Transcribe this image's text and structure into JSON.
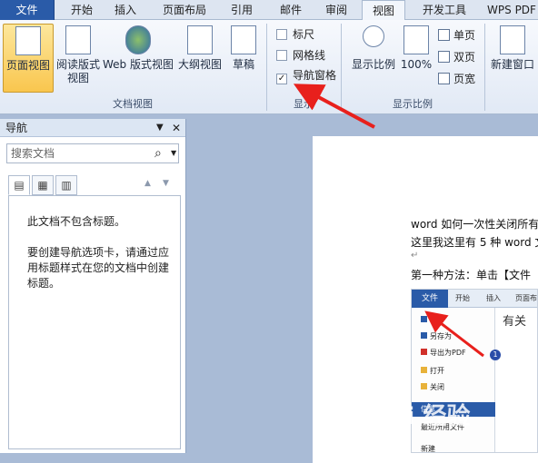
{
  "tabs": [
    "文件",
    "开始",
    "插入",
    "页面布局",
    "引用",
    "邮件",
    "审阅",
    "视图",
    "开发工具",
    "WPS PDF"
  ],
  "ribbon": {
    "doc_views": {
      "label": "文档视图",
      "buttons": [
        "页面视图",
        "阅读版式",
        "视图",
        "Web 版式视图",
        "大纲视图",
        "草稿"
      ]
    },
    "show": {
      "label": "显示",
      "items": [
        {
          "text": "标尺",
          "checked": false
        },
        {
          "text": "网格线",
          "checked": false
        },
        {
          "text": "导航窗格",
          "checked": true
        }
      ],
      "check_mark": "✓"
    },
    "zoom": {
      "label": "显示比例",
      "buttons": [
        "显示比例",
        "100%"
      ],
      "small": [
        "单页",
        "双页",
        "页宽"
      ]
    },
    "window": {
      "buttons": [
        "新建窗口"
      ]
    }
  },
  "nav": {
    "title": "导航",
    "dropdown_glyph": "▼",
    "close_glyph": "✕",
    "search_placeholder": "搜索文档",
    "search_glyph": "⌕",
    "up_glyph": "▲",
    "down_glyph": "▼",
    "tab_glyphs": [
      "▤",
      "▦",
      "▥"
    ],
    "body_line1": "此文档不包含标题。",
    "body_line2": "要创建导航选项卡，请通过应用标题样式在您的文档中创建标题。"
  },
  "doc": {
    "line1": "word 如何一次性关闭所有",
    "line2": "这里我这里有 5 种 word 文",
    "para_mark": "↵",
    "line3": "第一种方法：单击【文件"
  },
  "embedded": {
    "tabs": [
      "文件",
      "开始",
      "插入",
      "页面布"
    ],
    "menu": [
      "保",
      "另存为",
      "导出为PDF",
      "打开",
      "关闭",
      "信息",
      "最近所用文件",
      "新建"
    ],
    "badge": "1",
    "right_text": "有关"
  },
  "watermark": "Bai 经验",
  "colors": {
    "accent": "#2a5ba8",
    "arrow": "#e8201c",
    "selected": "#f9c64e"
  }
}
